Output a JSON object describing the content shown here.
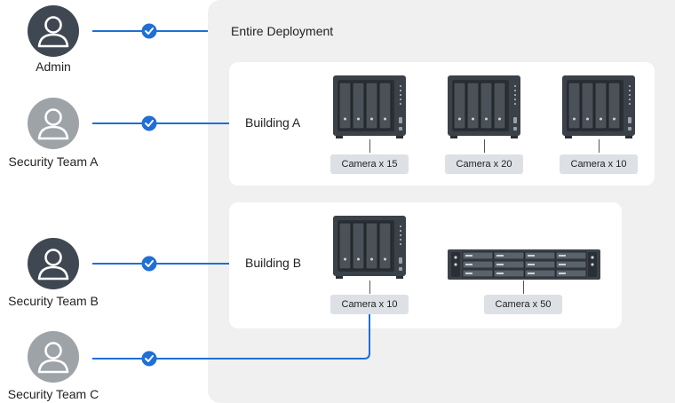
{
  "deployment": {
    "title": "Entire Deployment"
  },
  "roles": [
    {
      "label": "Admin",
      "color": "#3f4852"
    },
    {
      "label": "Security Team A",
      "color": "#9ea3a8"
    },
    {
      "label": "Security Team B",
      "color": "#3f4852"
    },
    {
      "label": "Security Team C",
      "color": "#9ea3a8"
    }
  ],
  "buildings": [
    {
      "label": "Building A",
      "devices": [
        {
          "type": "nas-4bay",
          "camera_label": "Camera x 15"
        },
        {
          "type": "nas-4bay",
          "camera_label": "Camera x 20"
        },
        {
          "type": "nas-4bay",
          "camera_label": "Camera x 10"
        }
      ]
    },
    {
      "label": "Building B",
      "devices": [
        {
          "type": "nas-4bay",
          "camera_label": "Camera x 10"
        },
        {
          "type": "rack-12bay",
          "camera_label": "Camera x 50"
        }
      ]
    }
  ],
  "colors": {
    "link": "#1f6fd6",
    "check": "#1f6fd6",
    "device": "#3b4148",
    "badge": "#dde1e5",
    "panel": "#f0f0f0"
  },
  "icons": {
    "avatar": "person-icon",
    "check": "check-circle-icon",
    "nas": "nas-4bay-icon",
    "rack": "rack-server-icon"
  }
}
